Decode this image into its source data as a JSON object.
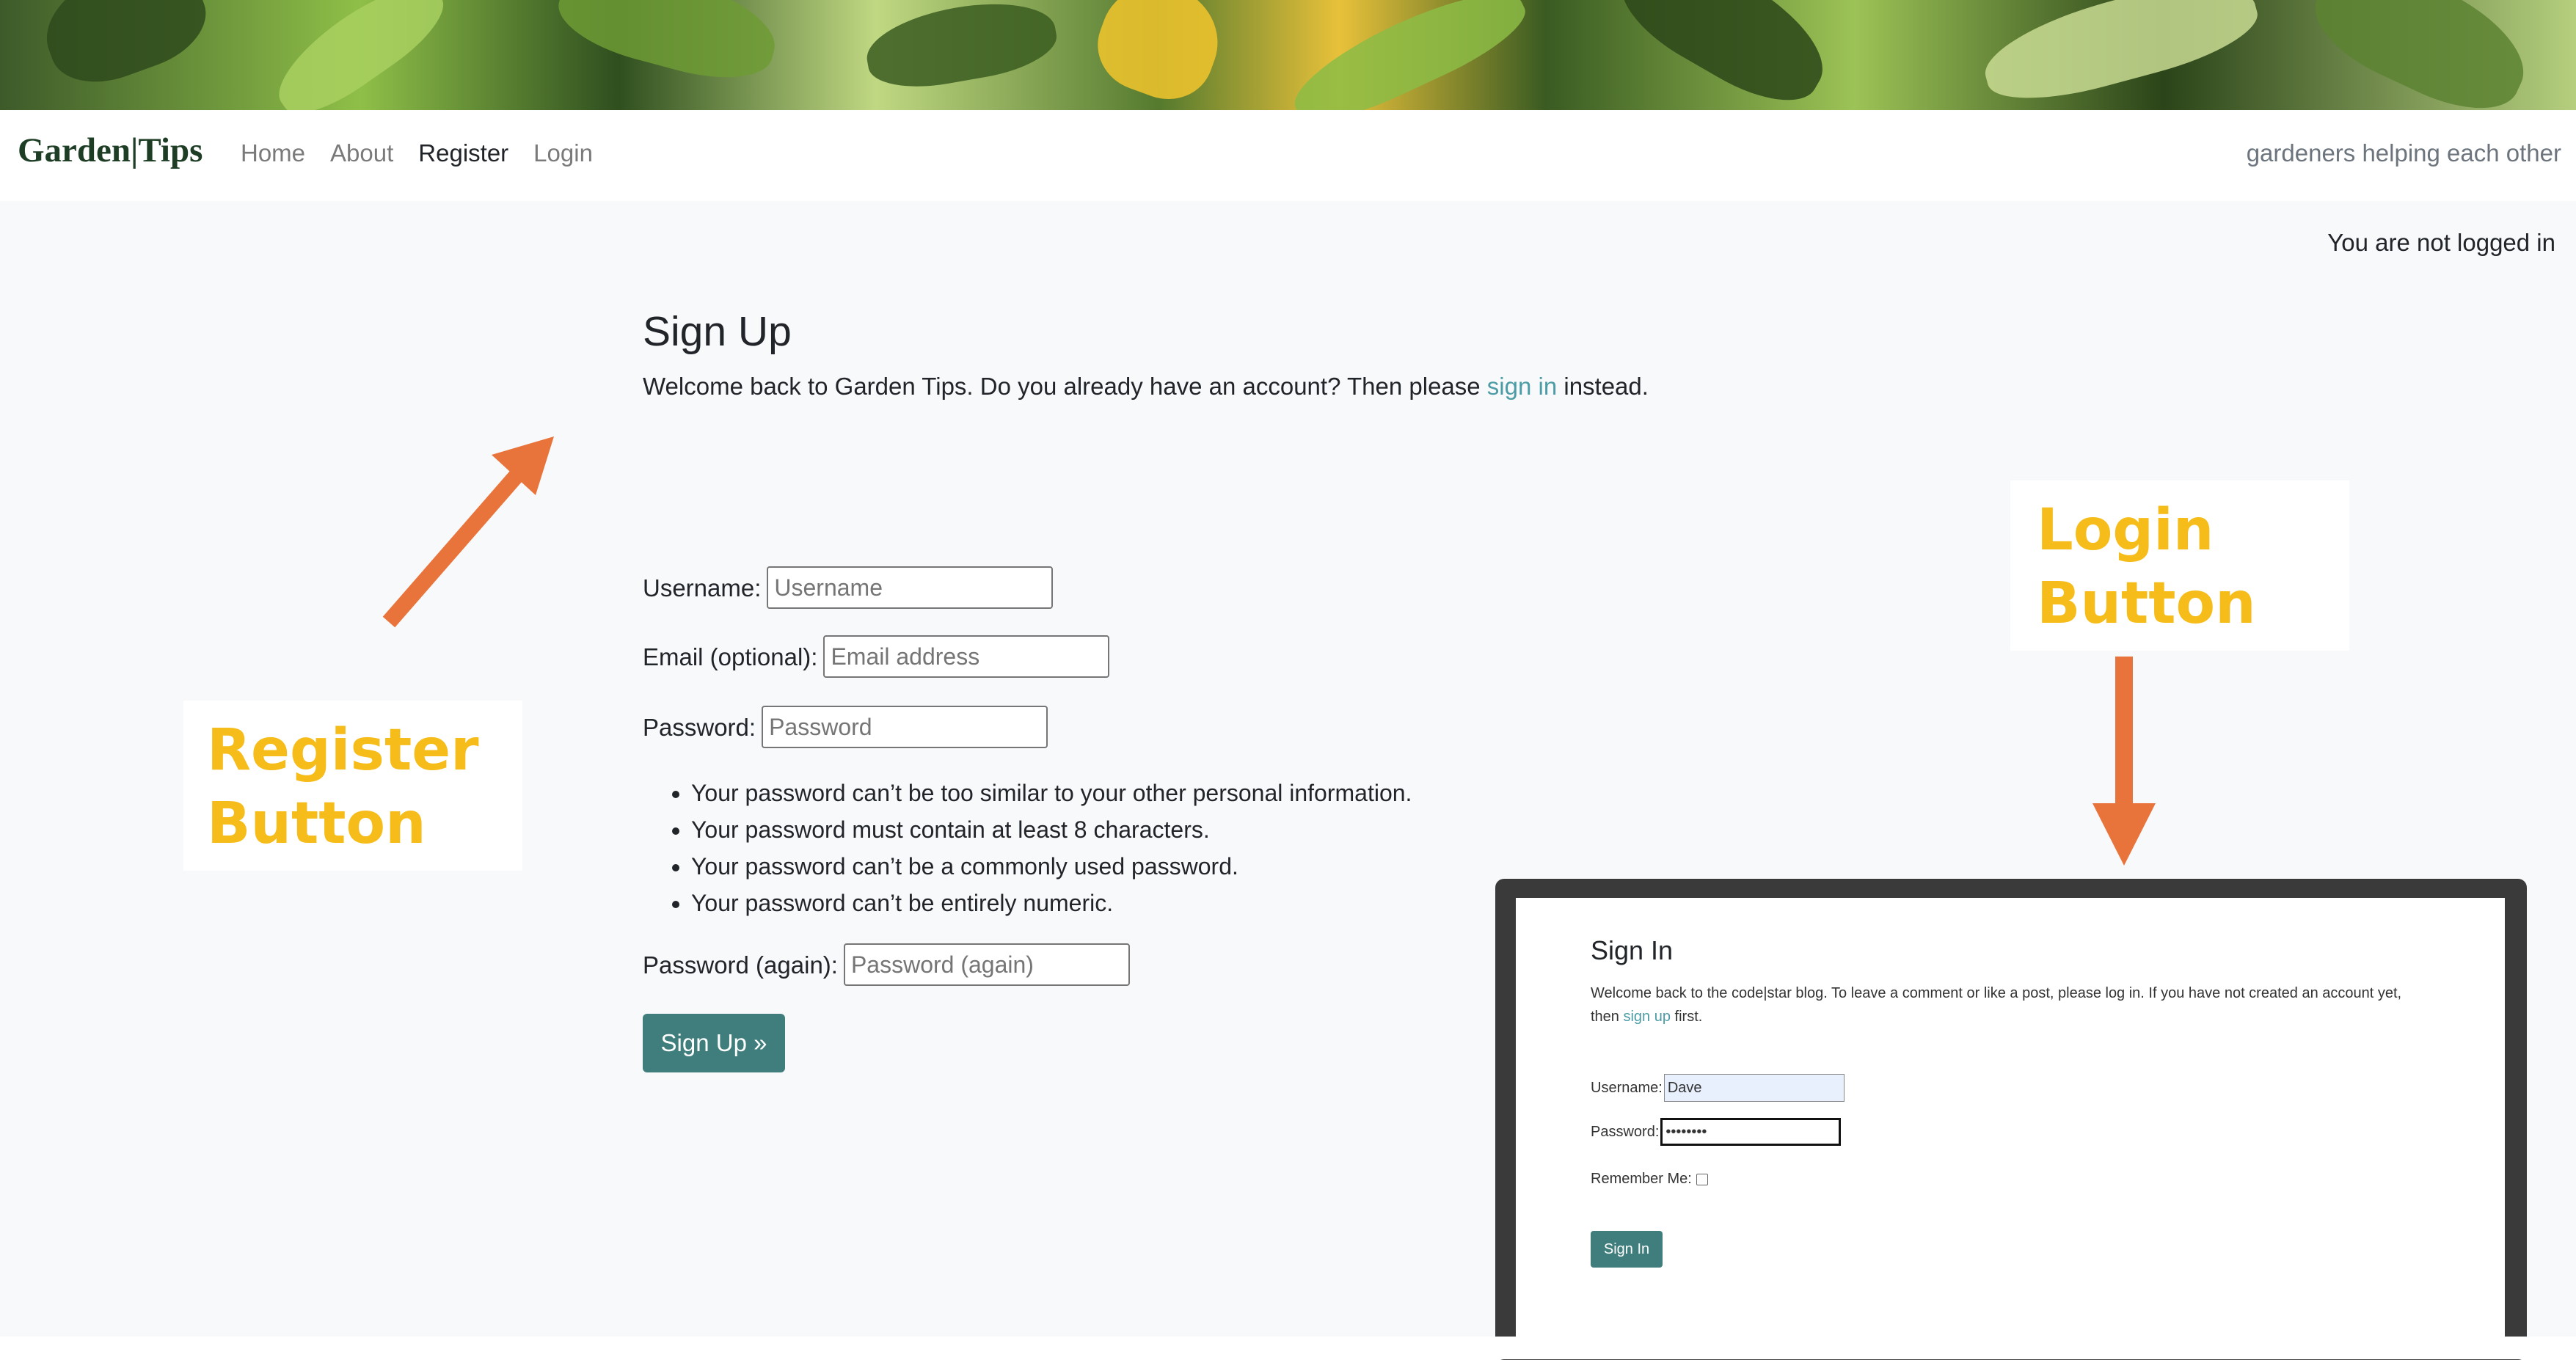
{
  "navbar": {
    "brand": "Garden|Tips",
    "links": [
      {
        "label": "Home",
        "active": false
      },
      {
        "label": "About",
        "active": false
      },
      {
        "label": "Register",
        "active": true
      },
      {
        "label": "Login",
        "active": false
      }
    ],
    "tagline": "gardeners helping each other"
  },
  "status": "You are not logged in",
  "signup": {
    "title": "Sign Up",
    "welcome_before": "Welcome back to Garden Tips. Do you already have an account? Then please ",
    "welcome_link": "sign in",
    "welcome_after": " instead.",
    "username_label": "Username:",
    "username_placeholder": "Username",
    "email_label": "Email (optional):",
    "email_placeholder": "Email address",
    "password_label": "Password:",
    "password_placeholder": "Password",
    "password_rules": [
      "Your password can’t be too similar to your other personal information.",
      "Your password must contain at least 8 characters.",
      "Your password can’t be a commonly used password.",
      "Your password can’t be entirely numeric."
    ],
    "password2_label": "Password (again):",
    "password2_placeholder": "Password (again)",
    "button": "Sign Up »"
  },
  "annotations": {
    "register": [
      "Register",
      "Button"
    ],
    "login": [
      "Login",
      "Button"
    ],
    "callout_color": "#f6bc1a",
    "arrow_color": "#e8743b"
  },
  "signin_inset": {
    "title": "Sign In",
    "welcome_before": "Welcome back to the code|star blog. To leave a comment or like a post, please log in. If you have not created an account yet, then ",
    "welcome_link": "sign up",
    "welcome_after": " first.",
    "username_label": "Username:",
    "username_value": "Dave",
    "password_label": "Password:",
    "password_value": "••••••••",
    "remember_label": "Remember Me:",
    "remember_checked": false,
    "button": "Sign In"
  },
  "colors": {
    "brand": "#1e3d25",
    "button": "#3f7e7c",
    "link": "#4b9ca6",
    "background": "#f8f9fa"
  }
}
